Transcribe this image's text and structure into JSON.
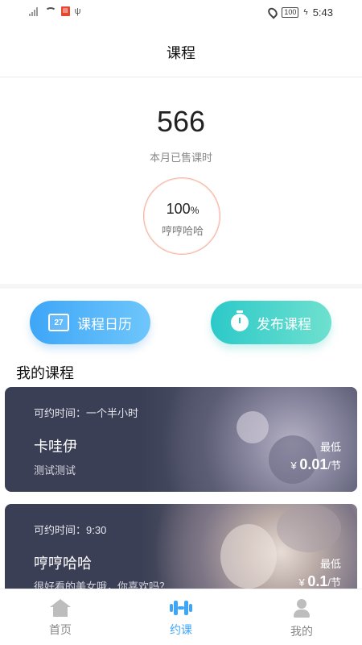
{
  "status_bar": {
    "battery": "100",
    "time": "5:43"
  },
  "header": {
    "title": "课程"
  },
  "stats": {
    "sold_value": "566",
    "sold_label": "本月已售课时",
    "ring_percent": "100",
    "ring_percent_unit": "%",
    "ring_label": "哼哼哈哈",
    "ring_color": "#f4b3a0"
  },
  "actions": {
    "calendar_icon_text": "27",
    "calendar_label": "课程日历",
    "publish_label": "发布课程"
  },
  "section": {
    "title": "我的课程"
  },
  "courses": [
    {
      "time": "可约时间：一个半小时",
      "name": "卡哇伊",
      "desc": "测试测试",
      "lowest_label": "最低",
      "currency": "¥",
      "price": "0.01",
      "unit": "/节"
    },
    {
      "time": "可约时间：9:30",
      "name": "哼哼哈哈",
      "desc": "很好看的美女哦，你喜欢吗？",
      "lowest_label": "最低",
      "currency": "¥",
      "price": "0.1",
      "unit": "/节"
    }
  ],
  "tabbar": {
    "items": [
      {
        "label": "首页",
        "icon": "home-icon",
        "active": false
      },
      {
        "label": "约课",
        "icon": "dumbbell-icon",
        "active": true
      },
      {
        "label": "我的",
        "icon": "user-icon",
        "active": false
      }
    ],
    "active_color": "#3ea6f7"
  },
  "colors": {
    "calendar_button": "#3ea6f7",
    "publish_button": "#2cc9c9",
    "card_background": "#3a3f55"
  }
}
